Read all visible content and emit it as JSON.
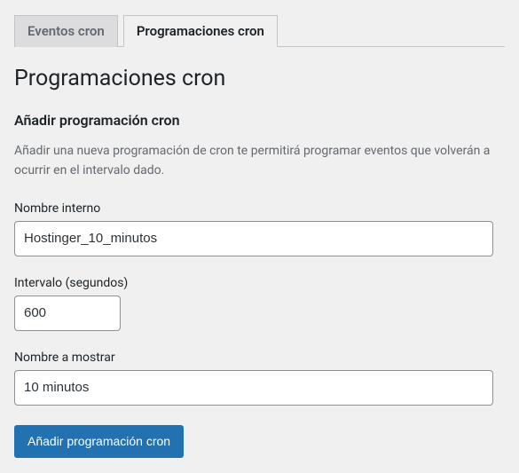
{
  "tabs": {
    "events": {
      "label": "Eventos cron",
      "active": false
    },
    "schedules": {
      "label": "Programaciones cron",
      "active": true
    }
  },
  "page": {
    "heading": "Programaciones cron",
    "subheading": "Añadir programación cron",
    "description": "Añadir una nueva programación de cron te permitirá programar eventos que volverán a ocurrir en el intervalo dado."
  },
  "form": {
    "internal_name": {
      "label": "Nombre interno",
      "value": "Hostinger_10_minutos"
    },
    "interval": {
      "label": "Intervalo (segundos)",
      "value": "600"
    },
    "display_name": {
      "label": "Nombre a mostrar",
      "value": "10 minutos"
    },
    "submit_label": "Añadir programación cron"
  }
}
